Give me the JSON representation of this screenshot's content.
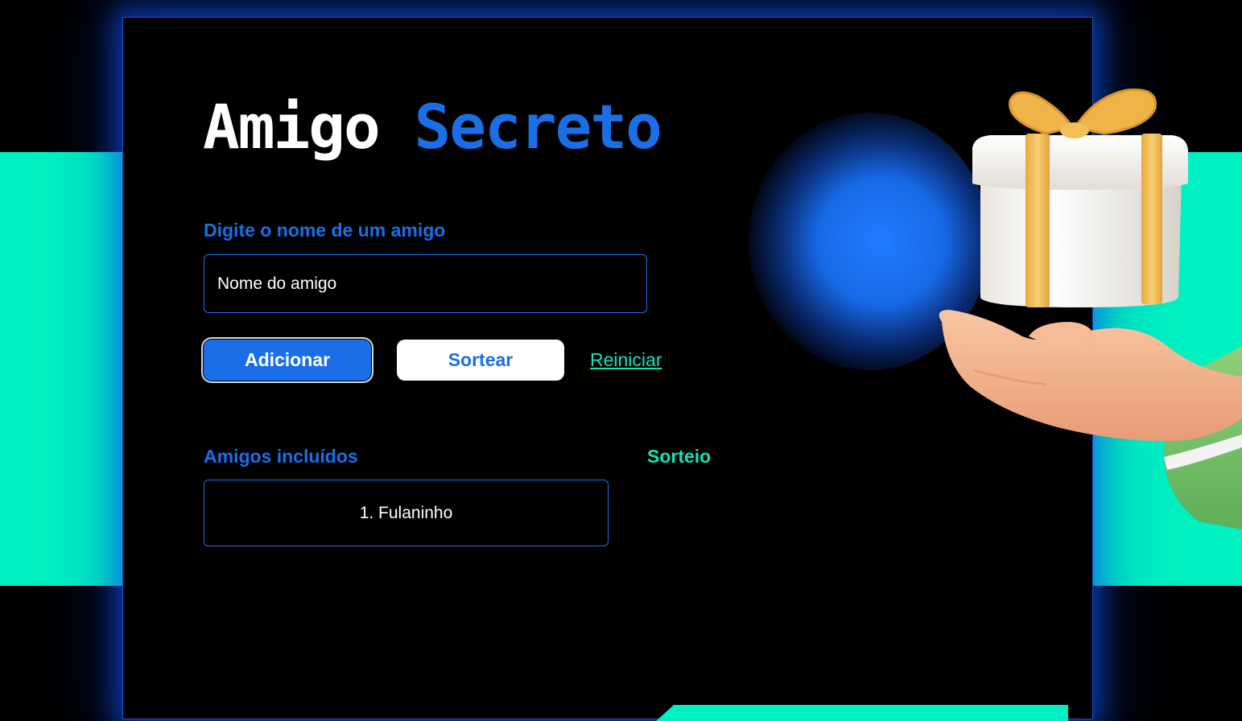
{
  "header": {
    "title_part1": "Amigo",
    "title_part2": "Secreto"
  },
  "form": {
    "name_label": "Digite o nome de um amigo",
    "input_placeholder": "Nome do amigo"
  },
  "actions": {
    "add_label": "Adicionar",
    "draw_label": "Sortear",
    "reset_label": "Reiniciar"
  },
  "friends_section": {
    "heading": "Amigos incluídos",
    "items": [
      "1. Fulaninho"
    ]
  },
  "result_section": {
    "heading": "Sorteio"
  },
  "illustration": {
    "icon": "gift-on-hand-icon"
  },
  "colors": {
    "accent_blue": "#1b6fe6",
    "accent_teal": "#00f0c2",
    "background": "#000000"
  }
}
